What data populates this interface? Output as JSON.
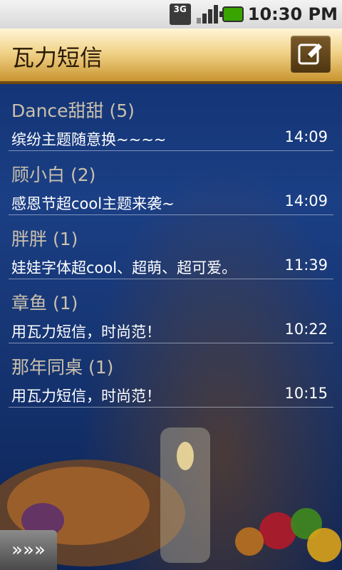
{
  "status_bar": {
    "network": "3G",
    "time": "10:30 PM"
  },
  "header": {
    "title": "瓦力短信",
    "compose_icon": "compose-icon"
  },
  "conversations": [
    {
      "sender": "Dance甜甜 (5)",
      "preview": "缤纷主题随意换~~~~",
      "time": "14:09"
    },
    {
      "sender": "顾小白 (2)",
      "preview": "感恩节超cool主题来袭~",
      "time": "14:09"
    },
    {
      "sender": "胖胖 (1)",
      "preview": "娃娃字体超cool、超萌、超可爱。",
      "time": "11:39"
    },
    {
      "sender": "章鱼 (1)",
      "preview": "用瓦力短信，时尚范！",
      "time": "10:22"
    },
    {
      "sender": "那年同桌 (1)",
      "preview": "用瓦力短信，时尚范！",
      "time": "10:15"
    }
  ],
  "footer": {
    "expand_label": "»»»"
  },
  "colors": {
    "title_bar": "#f1d38a",
    "background": "#1b3f85",
    "sender_text": "#c9c0ac",
    "preview_text": "#ffffff"
  }
}
